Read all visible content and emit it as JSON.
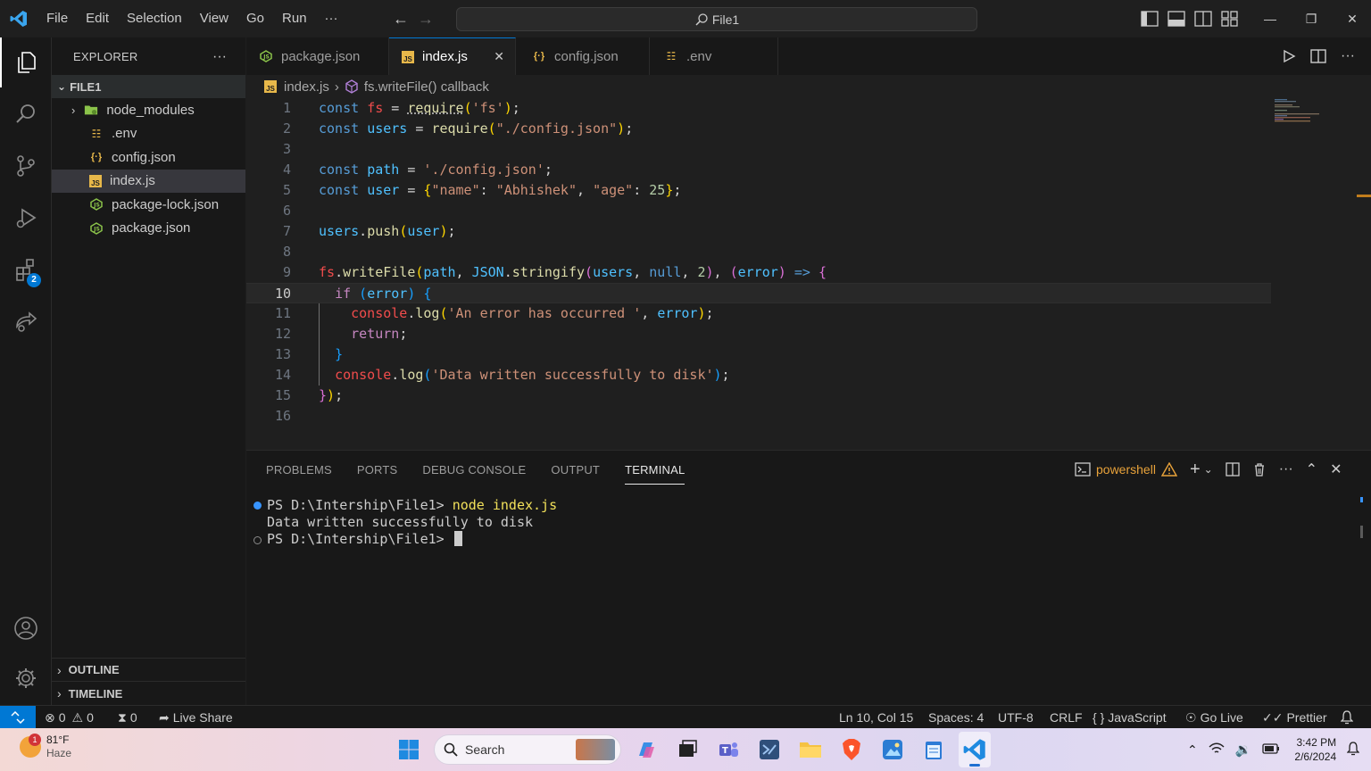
{
  "titlebar": {
    "menu": [
      "File",
      "Edit",
      "Selection",
      "View",
      "Go",
      "Run",
      "···"
    ],
    "search_text": "File1"
  },
  "activity": {
    "extensions_badge": "2"
  },
  "sidebar": {
    "title": "EXPLORER",
    "folder": "FILE1",
    "items": [
      {
        "label": "node_modules",
        "icon": "folder-icon"
      },
      {
        "label": ".env",
        "icon": "env-icon"
      },
      {
        "label": "config.json",
        "icon": "json-icon"
      },
      {
        "label": "index.js",
        "icon": "js-icon"
      },
      {
        "label": "package-lock.json",
        "icon": "npm-icon"
      },
      {
        "label": "package.json",
        "icon": "npm-icon"
      }
    ],
    "outline": "OUTLINE",
    "timeline": "TIMELINE"
  },
  "tabs": [
    {
      "label": "package.json"
    },
    {
      "label": "index.js"
    },
    {
      "label": "config.json"
    },
    {
      "label": ".env"
    }
  ],
  "breadcrumb": {
    "file": "index.js",
    "symbol": "fs.writeFile() callback"
  },
  "editor": {
    "line_numbers": [
      "1",
      "2",
      "3",
      "4",
      "5",
      "6",
      "7",
      "8",
      "9",
      "10",
      "11",
      "12",
      "13",
      "14",
      "15",
      "16"
    ],
    "current_line": "10"
  },
  "panel": {
    "tabs": [
      "PROBLEMS",
      "PORTS",
      "DEBUG CONSOLE",
      "OUTPUT",
      "TERMINAL"
    ],
    "shell": "powershell",
    "terminal": {
      "prompt": "PS D:\\Intership\\File1> ",
      "cmd": "node index.js",
      "output": "Data written successfully to disk",
      "prompt2": "PS D:\\Intership\\File1> "
    }
  },
  "status": {
    "errors": "0",
    "warnings": "0",
    "ports": "0",
    "live_share": "Live Share",
    "position": "Ln 10, Col 15",
    "spaces": "Spaces: 4",
    "encoding": "UTF-8",
    "eol": "CRLF",
    "language": "JavaScript",
    "go_live": "Go Live",
    "prettier": "Prettier"
  },
  "taskbar": {
    "weather_badge": "1",
    "temp": "81°F",
    "condition": "Haze",
    "search": "Search",
    "time": "3:42 PM",
    "date": "2/6/2024"
  }
}
